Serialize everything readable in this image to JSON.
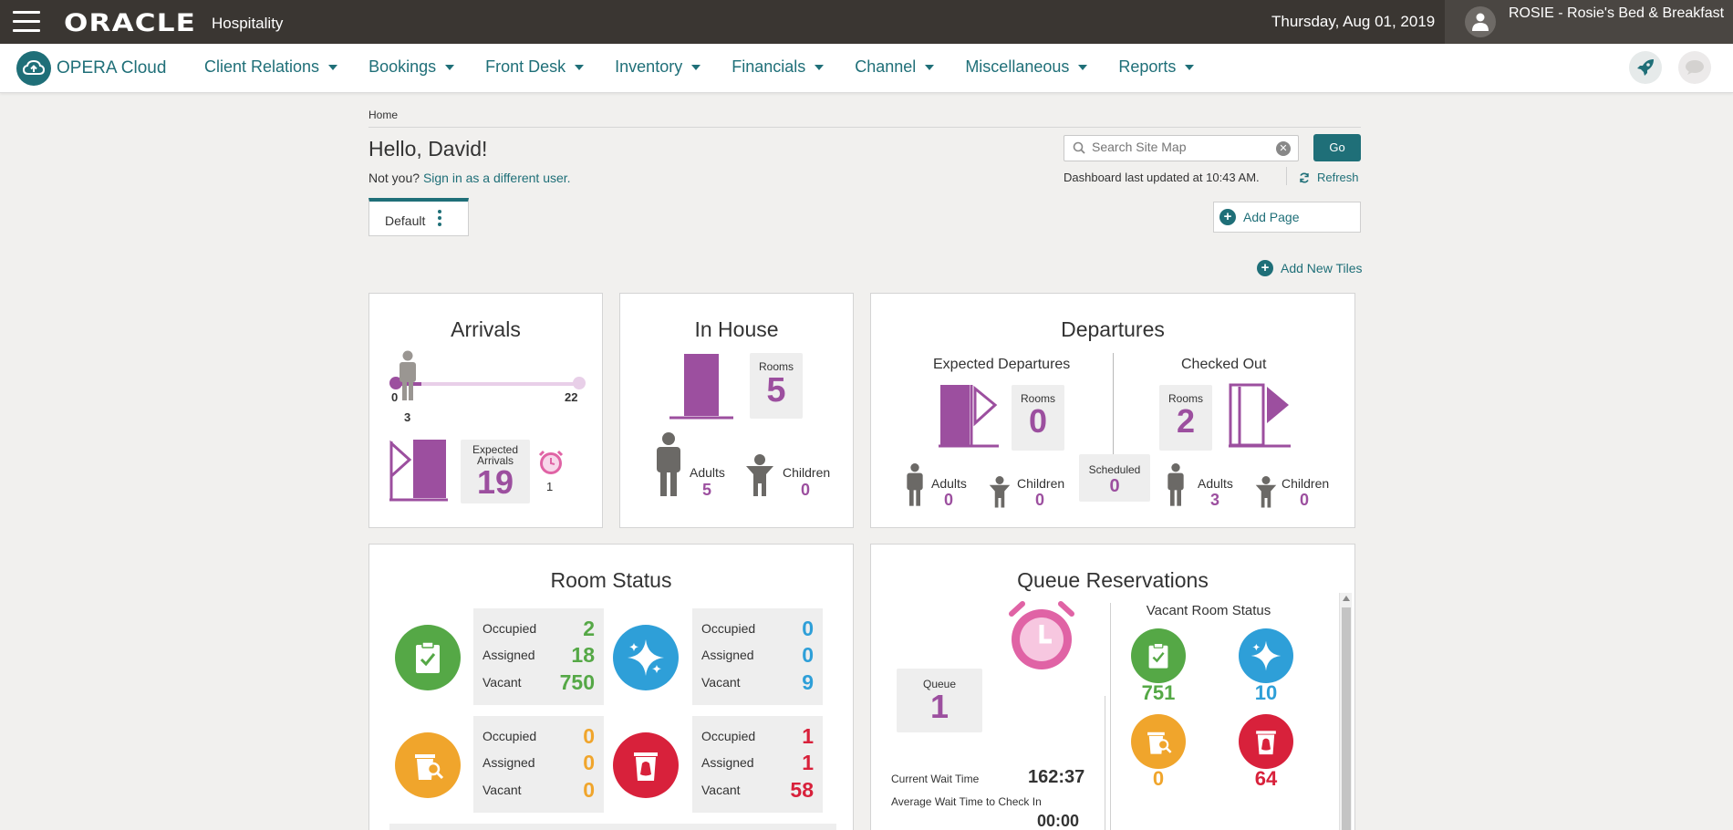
{
  "header": {
    "brand": "ORACLE",
    "product": "Hospitality",
    "date": "Thursday, Aug 01, 2019",
    "property": "ROSIE - Rosie's Bed & Breakfast"
  },
  "nav": {
    "app_name": "OPERA Cloud",
    "items": [
      "Client Relations",
      "Bookings",
      "Front Desk",
      "Inventory",
      "Financials",
      "Channel",
      "Miscellaneous",
      "Reports"
    ]
  },
  "page": {
    "breadcrumb": "Home",
    "greeting": "Hello, David!",
    "not_you": "Not you?",
    "sign_in_link": "Sign in as a different user.",
    "search_placeholder": "Search Site Map",
    "go_label": "Go",
    "updated_text": "Dashboard last updated at 10:43 AM.",
    "refresh_label": "Refresh",
    "tab_label": "Default",
    "add_page_label": "Add Page",
    "add_tiles_label": "Add New Tiles"
  },
  "arrivals": {
    "title": "Arrivals",
    "range_min": "0",
    "range_max": "22",
    "current": "3",
    "expected_label_1": "Expected",
    "expected_label_2": "Arrivals",
    "expected_value": "19",
    "alarm_value": "1",
    "progress_fraction": 0.136
  },
  "in_house": {
    "title": "In House",
    "rooms_label": "Rooms",
    "rooms_value": "5",
    "adults_label": "Adults",
    "adults_value": "5",
    "children_label": "Children",
    "children_value": "0"
  },
  "departures": {
    "title": "Departures",
    "expected_title": "Expected Departures",
    "checked_title": "Checked Out",
    "rooms_label": "Rooms",
    "expected_rooms": "0",
    "checked_rooms": "2",
    "adults_label": "Adults",
    "children_label": "Children",
    "exp_adults": "0",
    "exp_children": "0",
    "scheduled_label": "Scheduled",
    "scheduled_value": "0",
    "chk_adults": "3",
    "chk_children": "0"
  },
  "room_status": {
    "title": "Room Status",
    "labels": [
      "Occupied",
      "Assigned",
      "Vacant"
    ],
    "clean": [
      "2",
      "18",
      "750"
    ],
    "inspected": [
      "0",
      "0",
      "9"
    ],
    "pickup": [
      "0",
      "0",
      "0"
    ],
    "dirty": [
      "1",
      "1",
      "58"
    ],
    "colors": {
      "clean": "#55a846",
      "inspected": "#2e9fd8",
      "pickup": "#f0a52c",
      "dirty": "#d8213b"
    }
  },
  "queue": {
    "title": "Queue Reservations",
    "queue_label": "Queue",
    "queue_value": "1",
    "wait_label": "Current Wait Time",
    "wait_value": "162:37",
    "avg_label": "Average Wait Time to Check In",
    "avg_value": "00:00",
    "vacant_title": "Vacant Room Status",
    "vacant_clean": "751",
    "vacant_inspected": "10",
    "vacant_pickup": "0",
    "vacant_dirty": "64"
  }
}
